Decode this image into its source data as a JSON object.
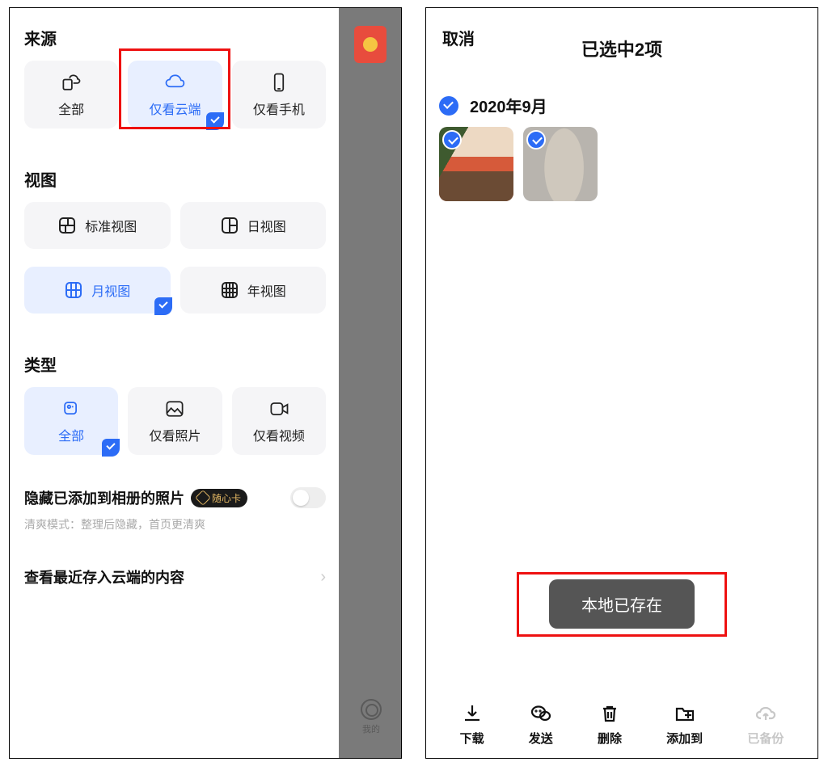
{
  "left": {
    "source": {
      "title": "来源",
      "options": [
        {
          "label": "全部",
          "selected": false
        },
        {
          "label": "仅看云端",
          "selected": true
        },
        {
          "label": "仅看手机",
          "selected": false
        }
      ]
    },
    "view": {
      "title": "视图",
      "options": [
        {
          "label": "标准视图",
          "selected": false
        },
        {
          "label": "日视图",
          "selected": false
        },
        {
          "label": "月视图",
          "selected": true
        },
        {
          "label": "年视图",
          "selected": false
        }
      ]
    },
    "type": {
      "title": "类型",
      "options": [
        {
          "label": "全部",
          "selected": true
        },
        {
          "label": "仅看照片",
          "selected": false
        },
        {
          "label": "仅看视频",
          "selected": false
        }
      ]
    },
    "hide": {
      "title": "隐藏已添加到相册的照片",
      "badge": "随心卡",
      "sub_prefix": "清爽模式：",
      "sub_rest": "整理后隐藏，首页更清爽",
      "enabled": false
    },
    "recent": {
      "label": "查看最近存入云端的内容"
    },
    "bottom_my": "我的"
  },
  "right": {
    "cancel": "取消",
    "title": "已选中2项",
    "group_date": "2020年9月",
    "selected_count": 2,
    "toast": "本地已存在",
    "bottom": {
      "download": "下载",
      "send": "发送",
      "delete": "删除",
      "addto": "添加到",
      "backedup": "已备份"
    }
  }
}
